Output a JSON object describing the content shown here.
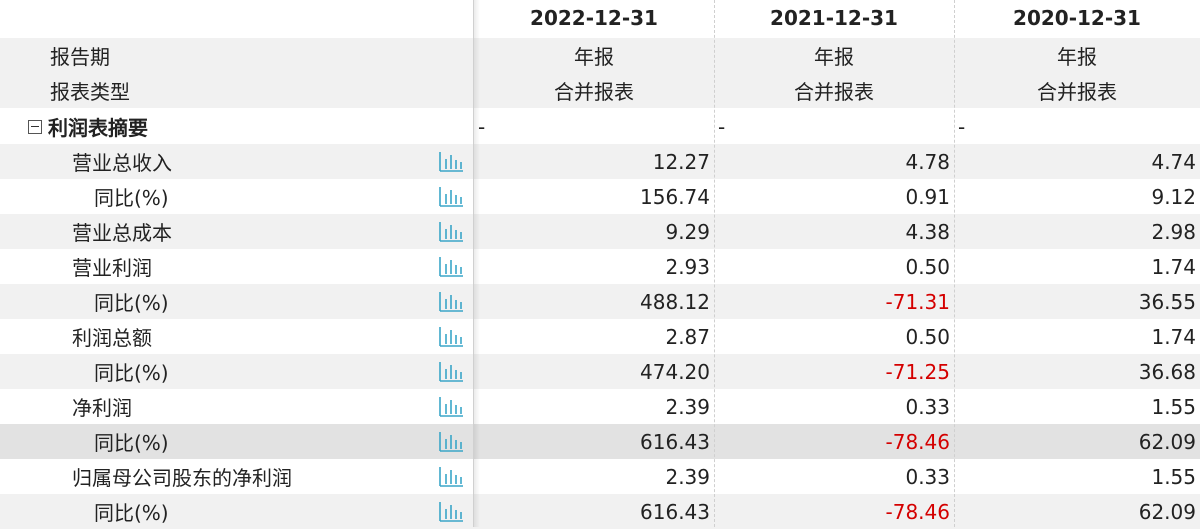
{
  "header": {
    "periods": [
      "2022-12-31",
      "2021-12-31",
      "2020-12-31"
    ]
  },
  "meta_rows": [
    {
      "label": "报告期",
      "values": [
        "年报",
        "年报",
        "年报"
      ]
    },
    {
      "label": "报表类型",
      "values": [
        "合并报表",
        "合并报表",
        "合并报表"
      ]
    }
  ],
  "section": {
    "label": "利润表摘要",
    "values": [
      "-",
      "-",
      "-"
    ]
  },
  "rows": [
    {
      "label": "营业总收入",
      "values": [
        "12.27",
        "4.78",
        "4.74"
      ]
    },
    {
      "label": "同比(%)",
      "values": [
        "156.74",
        "0.91",
        "9.12"
      ]
    },
    {
      "label": "营业总成本",
      "values": [
        "9.29",
        "4.38",
        "2.98"
      ]
    },
    {
      "label": "营业利润",
      "values": [
        "2.93",
        "0.50",
        "1.74"
      ]
    },
    {
      "label": "同比(%)",
      "values": [
        "488.12",
        "-71.31",
        "36.55"
      ]
    },
    {
      "label": "利润总额",
      "values": [
        "2.87",
        "0.50",
        "1.74"
      ]
    },
    {
      "label": "同比(%)",
      "values": [
        "474.20",
        "-71.25",
        "36.68"
      ]
    },
    {
      "label": "净利润",
      "values": [
        "2.39",
        "0.33",
        "1.55"
      ]
    },
    {
      "label": "同比(%)",
      "values": [
        "616.43",
        "-78.46",
        "62.09"
      ]
    },
    {
      "label": "归属母公司股东的净利润",
      "values": [
        "2.39",
        "0.33",
        "1.55"
      ]
    },
    {
      "label": "同比(%)",
      "values": [
        "616.43",
        "-78.46",
        "62.09"
      ]
    }
  ],
  "colors": {
    "negative": "#d40000",
    "icon": "#3aa6c8",
    "row_gray": "#f1f1f1",
    "row_highlight": "#e2e2e2"
  },
  "icons": {
    "row_chart": "bar-chart-icon",
    "collapse": "collapse-icon"
  }
}
